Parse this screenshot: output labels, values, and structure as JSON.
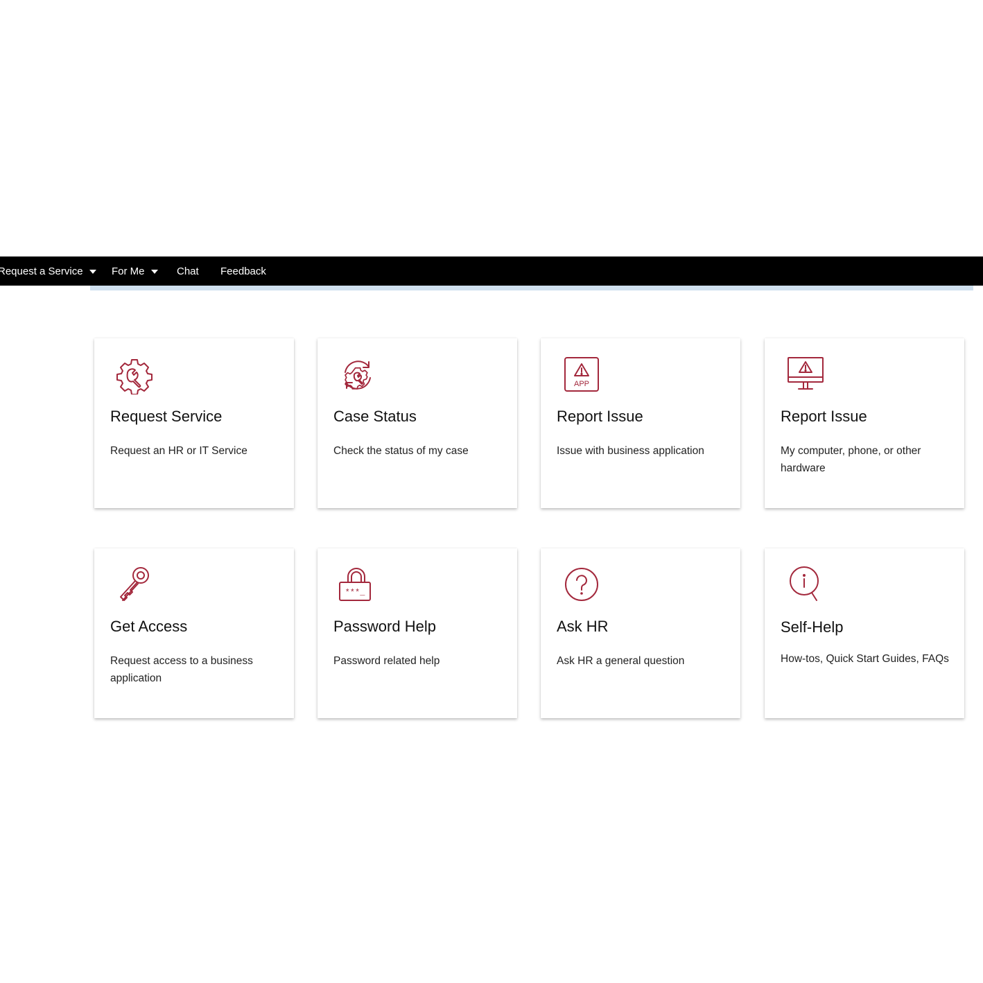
{
  "nav": {
    "items": [
      {
        "label": "Request a Service",
        "dropdown": true
      },
      {
        "label": "For Me",
        "dropdown": true
      },
      {
        "label": "Chat",
        "dropdown": false
      },
      {
        "label": "Feedback",
        "dropdown": false
      }
    ]
  },
  "colors": {
    "accent": "#a3283c",
    "navbar": "#000000",
    "subbar": "#cfe0ef"
  },
  "cards": [
    {
      "icon": "gear-wrench-icon",
      "title": "Request Service",
      "description": "Request an HR or IT Service"
    },
    {
      "icon": "case-status-refresh-icon",
      "title": "Case Status",
      "description": "Check the status of my case"
    },
    {
      "icon": "app-warning-icon",
      "title": "Report Issue",
      "description": "Issue with business application"
    },
    {
      "icon": "monitor-warning-icon",
      "title": "Report Issue",
      "description": "My computer, phone, or other hardware"
    },
    {
      "icon": "key-icon",
      "title": "Get Access",
      "description": "Request access to a business application"
    },
    {
      "icon": "password-lock-icon",
      "title": "Password Help",
      "description": "Password related help"
    },
    {
      "icon": "question-circle-icon",
      "title": "Ask HR",
      "description": "Ask HR a general question"
    },
    {
      "icon": "info-search-icon",
      "title": "Self-Help",
      "description": "How-tos, Quick Start Guides, FAQs"
    }
  ],
  "icon_text": {
    "app": "APP",
    "password_mask": "***_"
  }
}
